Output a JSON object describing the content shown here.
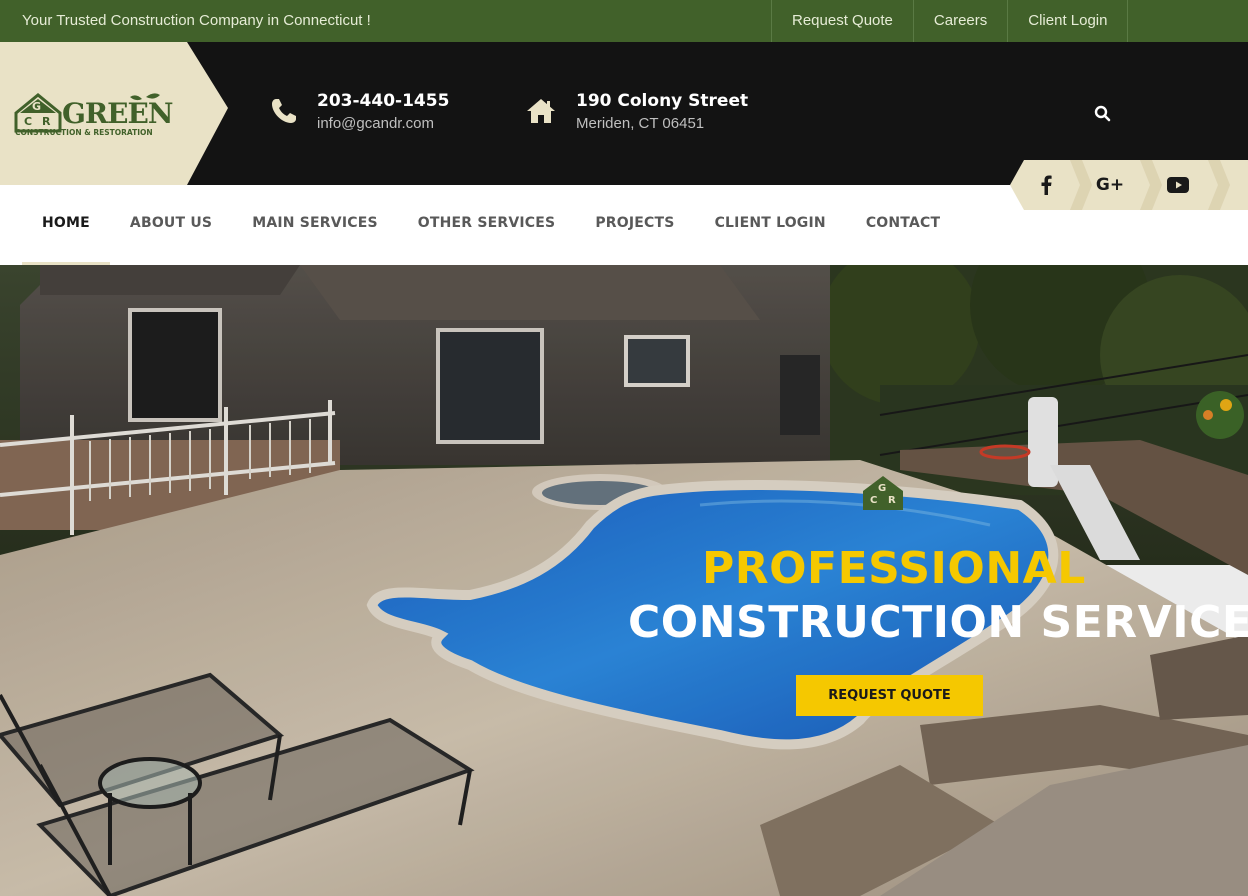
{
  "topbar": {
    "tagline": "Your Trusted Construction Company in Connecticut !",
    "links": [
      "Request Quote",
      "Careers",
      "Client Login"
    ]
  },
  "logo": {
    "letters": [
      "G",
      "C",
      "R"
    ],
    "word": "GREEN",
    "sub": "CONSTRUCTION & RESTORATION"
  },
  "contact": {
    "phone": "203-440-1455",
    "email": "info@gcandr.com",
    "address": "190 Colony Street",
    "city": "Meriden, CT 06451",
    "phone_icon": "phone-icon",
    "address_icon": "home-icon"
  },
  "social": [
    "facebook-icon",
    "google-plus-icon",
    "youtube-icon"
  ],
  "social_labels": {
    "google": "G+"
  },
  "nav": {
    "items": [
      "HOME",
      "ABOUT US",
      "MAIN SERVICES",
      "OTHER SERVICES",
      "PROJECTS",
      "CLIENT LOGIN",
      "CONTACT"
    ],
    "active": "HOME"
  },
  "hero": {
    "title_line1": "PROFESSIONAL",
    "title_line2": "CONSTRUCTION SERVICE",
    "button": "REQUEST QUOTE",
    "badge_letters": [
      "G",
      "C",
      "R"
    ]
  },
  "colors": {
    "brand_green": "#41612a",
    "header_dark": "#131313",
    "cream": "#e9e2c6",
    "accent_yellow": "#f5c800"
  }
}
